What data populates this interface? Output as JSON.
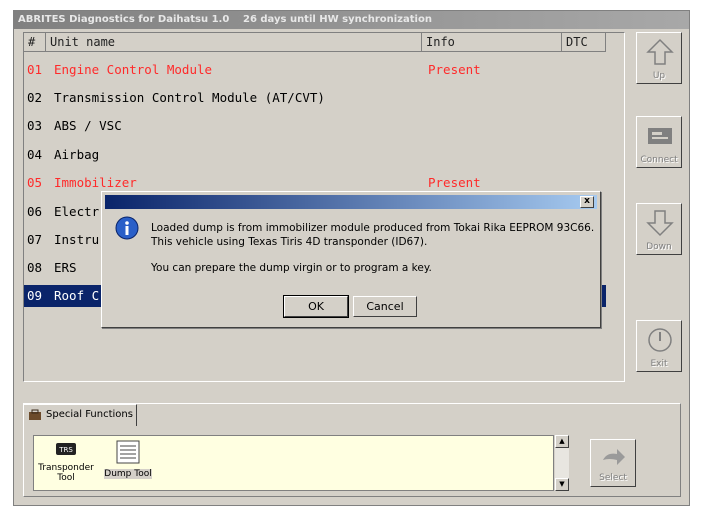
{
  "window": {
    "title": "ABRITES Diagnostics for Daihatsu 1.0",
    "sync_status": "26 days until HW synchronization"
  },
  "units_table": {
    "columns": [
      "#",
      "Unit name",
      "Info",
      "DTC"
    ],
    "rows": [
      {
        "num": "01",
        "name": "Engine Control Module",
        "info": "Present",
        "state": "present"
      },
      {
        "num": "02",
        "name": "Transmission Control Module (AT/CVT)",
        "info": "",
        "state": "normal"
      },
      {
        "num": "03",
        "name": "ABS / VSC",
        "info": "",
        "state": "normal"
      },
      {
        "num": "04",
        "name": "Airbag",
        "info": "",
        "state": "normal"
      },
      {
        "num": "05",
        "name": "Immobilizer",
        "info": "Present",
        "state": "present"
      },
      {
        "num": "06",
        "name": "Electr",
        "info": "",
        "state": "normal"
      },
      {
        "num": "07",
        "name": "Instru",
        "info": "",
        "state": "normal"
      },
      {
        "num": "08",
        "name": "ERS",
        "info": "",
        "state": "normal"
      },
      {
        "num": "09",
        "name": "Roof C",
        "info": "",
        "state": "selected"
      }
    ]
  },
  "side_buttons": {
    "up": "Up",
    "connect": "Connect",
    "down": "Down",
    "exit": "Exit"
  },
  "special_functions": {
    "tab_label": "Special Functions",
    "tools": [
      {
        "label": "Transponder Tool",
        "icon": "transponder-icon",
        "badge": "TRS"
      },
      {
        "label": "Dump Tool",
        "icon": "dump-tool-icon"
      }
    ],
    "select_label": "Select"
  },
  "dialog": {
    "line1": "Loaded dump is from immobilizer module produced from Tokai Rika EEPROM 93C66.",
    "line2": "This vehicle using Texas Tiris 4D transponder (ID67).",
    "line3": "You can prepare the dump virgin or to program a key.",
    "ok_label": "OK",
    "cancel_label": "Cancel",
    "close_glyph": "x"
  },
  "colors": {
    "present_text": "#ff2a2a",
    "selection": "#0a246a",
    "dialog_title_start": "#0a246a"
  }
}
